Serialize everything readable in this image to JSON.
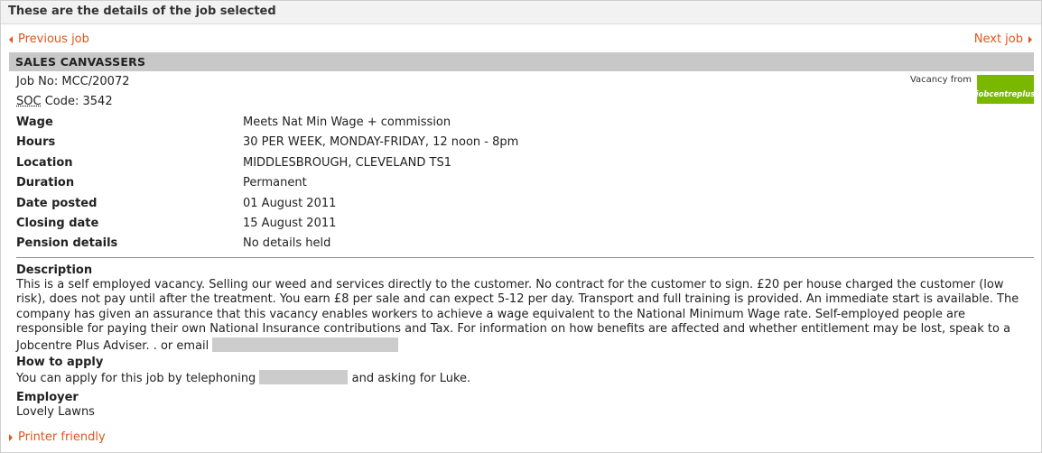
{
  "header": {
    "title": "These are the details of the job selected"
  },
  "nav": {
    "previous_label": "Previous job",
    "next_label": "Next job"
  },
  "job": {
    "title": "SALES CANVASSERS",
    "job_no_label": "Job No:",
    "job_no": "MCC/20072",
    "soc_abbr": "SOC",
    "soc_label_rest": " Code:",
    "soc_code": "3542",
    "vacancy_from": "Vacancy from",
    "logo_text": "jobcentreplus"
  },
  "details": [
    {
      "label": "Wage",
      "value": "Meets Nat Min Wage + commission"
    },
    {
      "label": "Hours",
      "value": "30 PER WEEK, MONDAY-FRIDAY, 12 noon - 8pm"
    },
    {
      "label": "Location",
      "value": "MIDDLESBROUGH, CLEVELAND TS1"
    },
    {
      "label": "Duration",
      "value": "Permanent"
    },
    {
      "label": "Date posted",
      "value": "01 August 2011"
    },
    {
      "label": "Closing date",
      "value": "15 August 2011"
    },
    {
      "label": "Pension details",
      "value": "No details held"
    }
  ],
  "description": {
    "heading": "Description",
    "text": "This is a self employed vacancy. Selling our weed and services directly to the customer. No contract for the customer to sign. £20 per house charged the customer (low risk), does not pay until after the treatment. You earn £8 per sale and can expect 5-12 per day. Transport and full training is provided. An immediate start is available. The company has given an assurance that this vacancy enables workers to achieve a wage equivalent to the National Minimum Wage rate. Self-employed people are responsible for paying their own National Insurance contributions and Tax. For information on how benefits are affected and whether entitlement may be lost, speak to a Jobcentre Plus Adviser. . or email"
  },
  "how_to_apply": {
    "heading": "How to apply",
    "text_before": "You can apply for this job by telephoning",
    "text_after": "and asking for Luke."
  },
  "employer": {
    "heading": "Employer",
    "name": "Lovely Lawns"
  },
  "footer": {
    "printer_label": "Printer friendly"
  },
  "colors": {
    "link": "#e0561a",
    "title_bar": "#c8c8c8",
    "header_bar": "#f2f2f2",
    "logo": "#7ab800",
    "redacted": "#cccccc"
  }
}
